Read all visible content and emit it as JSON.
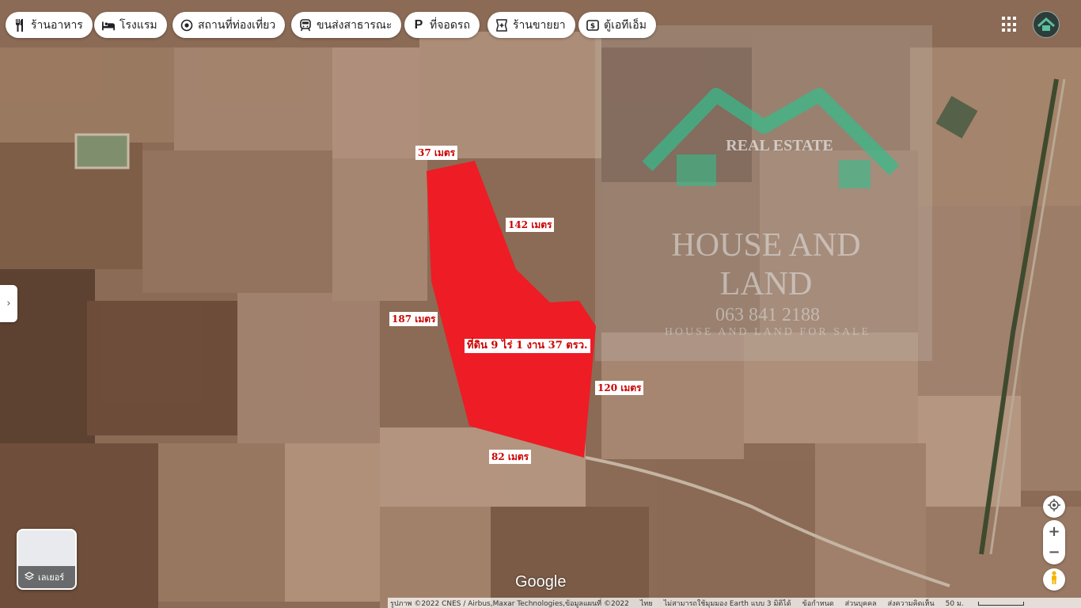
{
  "categories": [
    {
      "label": "ร้านอาหาร",
      "icon": "utensils-icon"
    },
    {
      "label": "โรงแรม",
      "icon": "bed-icon"
    },
    {
      "label": "สถานที่ท่องเที่ยว",
      "icon": "camera-icon"
    },
    {
      "label": "ขนส่งสาธารณะ",
      "icon": "train-icon"
    },
    {
      "label": "ที่จอดรถ",
      "icon": "parking-icon"
    },
    {
      "label": "ร้านขายยา",
      "icon": "pharmacy-icon"
    },
    {
      "label": "ตู้เอทีเอ็ม",
      "icon": "atm-icon"
    }
  ],
  "overlay": {
    "real_estate": "REAL ESTATE",
    "house_and_land": "HOUSE AND",
    "land": "LAND",
    "phone": "063 841 2188",
    "tagline": "HOUSE AND LAND FOR SALE"
  },
  "plot": {
    "fill_color": "#ee1c25",
    "labels": {
      "top": "37 เมตร",
      "northeast": "142 เมตร",
      "west": "187 เมตร",
      "area": "ที่ดิน 9 ไร่ 1 งาน 37 ตรว.",
      "east": "120 เมตร",
      "south": "82 เมตร"
    }
  },
  "layers": {
    "label": "เลเยอร์"
  },
  "branding": {
    "google": "Google"
  },
  "footer": {
    "imagery": "รูปภาพ ©2022 CNES / Airbus,Maxar Technologies,ข้อมูลแผนที่ ©2022",
    "language": "ไทย",
    "earth": "ไม่สามารถใช้มุมมอง Earth แบบ 3 มิติได้",
    "terms": "ข้อกำหนด",
    "privacy": "ส่วนบุคคล",
    "feedback": "ส่งความคิดเห็น",
    "scale": "50 ม."
  }
}
